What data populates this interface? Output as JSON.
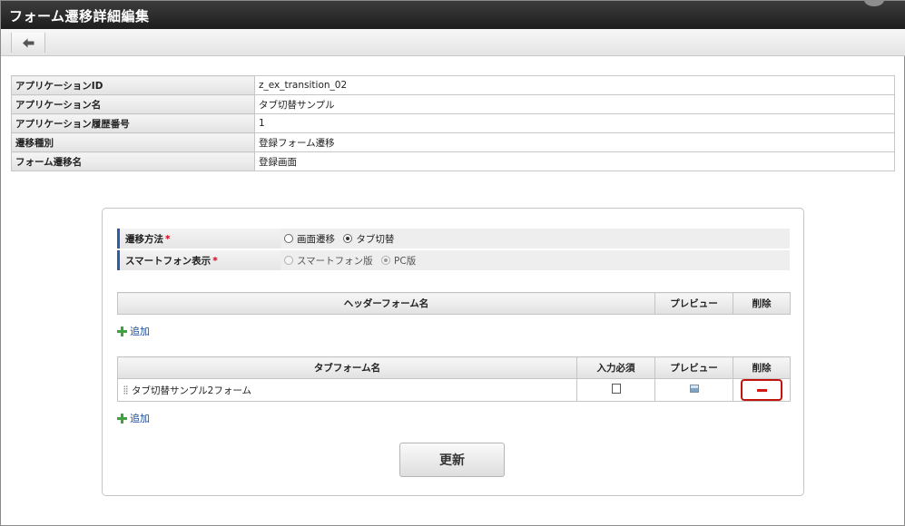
{
  "window": {
    "title": "フォーム遷移詳細編集"
  },
  "toolbar": {
    "back_icon": "arrow-left-icon"
  },
  "info_table": [
    {
      "label": "アプリケーションID",
      "value": "z_ex_transition_02"
    },
    {
      "label": "アプリケーション名",
      "value": "タブ切替サンプル"
    },
    {
      "label": "アプリケーション履歴番号",
      "value": "1"
    },
    {
      "label": "遷移種別",
      "value": "登録フォーム遷移"
    },
    {
      "label": "フォーム遷移名",
      "value": "登録画面"
    }
  ],
  "options": {
    "transition_method": {
      "label": "遷移方法",
      "required_mark": "*",
      "choices": [
        {
          "label": "画面遷移",
          "selected": false
        },
        {
          "label": "タブ切替",
          "selected": true
        }
      ]
    },
    "smartphone_display": {
      "label": "スマートフォン表示",
      "required_mark": "*",
      "disabled": true,
      "choices": [
        {
          "label": "スマートフォン版",
          "selected": false
        },
        {
          "label": "PC版",
          "selected": true
        }
      ]
    }
  },
  "header_form_table": {
    "columns": {
      "name": "ヘッダーフォーム名",
      "preview": "プレビュー",
      "delete": "削除"
    },
    "rows": []
  },
  "header_add_link": "追加",
  "tab_form_table": {
    "columns": {
      "name": "タブフォーム名",
      "required": "入力必須",
      "preview": "プレビュー",
      "delete": "削除"
    },
    "rows": [
      {
        "name": "タブ切替サンプル2フォーム",
        "required": false
      }
    ]
  },
  "tab_add_link": "追加",
  "update_button": "更新",
  "colors": {
    "accent_border": "#2b5ca8",
    "delete_highlight": "#c0140c",
    "add_icon": "#3ea33e",
    "link": "#1c4f9c"
  }
}
